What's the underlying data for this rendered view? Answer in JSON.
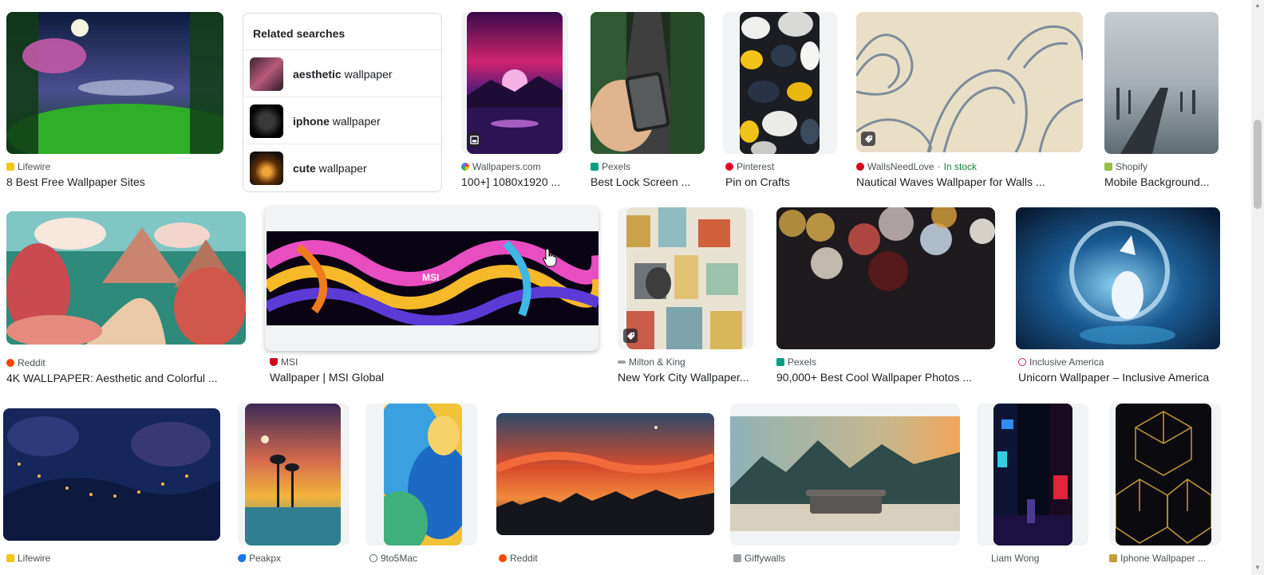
{
  "related": {
    "title": "Related searches",
    "items": [
      {
        "bold": "aesthetic",
        "rest": " wallpaper"
      },
      {
        "bold": "iphone",
        "rest": " wallpaper"
      },
      {
        "bold": "cute",
        "rest": " wallpaper"
      }
    ]
  },
  "row1": [
    {
      "source": "Lifewire",
      "title": "8 Best Free Wallpaper Sites",
      "icon": "lifewire-icon"
    },
    {
      "source": "Wallpapers.com",
      "title": "100+] 1080x1920 ...",
      "icon": "wallpapers-com-icon"
    },
    {
      "source": "Pexels",
      "title": "Best Lock Screen ...",
      "icon": "pexels-icon"
    },
    {
      "source": "Pinterest",
      "title": "Pin on Crafts",
      "icon": "pinterest-icon"
    },
    {
      "source": "WallsNeedLove",
      "title": "Nautical Waves Wallpaper for Walls ...",
      "stock": "In stock",
      "sep": "·",
      "icon": "wallsneedlove-icon"
    },
    {
      "source": "Shopify",
      "title": "Mobile Background...",
      "icon": "shopify-icon"
    }
  ],
  "row2": [
    {
      "source": "Reddit",
      "title": "4K WALLPAPER: Aesthetic and Colorful ...",
      "icon": "reddit-icon"
    },
    {
      "source": "MSI",
      "title": "Wallpaper | MSI Global",
      "icon": "msi-icon",
      "logo": "MSI"
    },
    {
      "source": "Milton & King",
      "title": "New York City Wallpaper...",
      "icon": "milton-king-icon"
    },
    {
      "source": "Pexels",
      "title": "90,000+ Best Cool Wallpaper Photos ...",
      "icon": "pexels-icon"
    },
    {
      "source": "Inclusive America",
      "title": "Unicorn Wallpaper – Inclusive America",
      "icon": "inclusive-america-icon"
    }
  ],
  "row3": [
    {
      "source": "Lifewire",
      "icon": "lifewire-icon"
    },
    {
      "source": "Peakpx",
      "icon": "peakpx-icon"
    },
    {
      "source": "9to5Mac",
      "icon": "9to5mac-icon"
    },
    {
      "source": "Reddit",
      "icon": "reddit-icon"
    },
    {
      "source": "Giffywalls",
      "icon": "giffywalls-icon"
    },
    {
      "source": "Liam Wong",
      "icon": ""
    },
    {
      "source": "Iphone Wallpaper ...",
      "icon": "iphone-wallpaper-icon"
    }
  ],
  "colors": {
    "text": "#202124",
    "source_text": "#4d5156",
    "in_stock": "#188038",
    "lifewire": "#f5c518",
    "pexels": "#05a081",
    "pinterest": "#e60023",
    "reddit": "#ff4500",
    "shopify": "#95bf47",
    "msi": "#d0021b"
  }
}
